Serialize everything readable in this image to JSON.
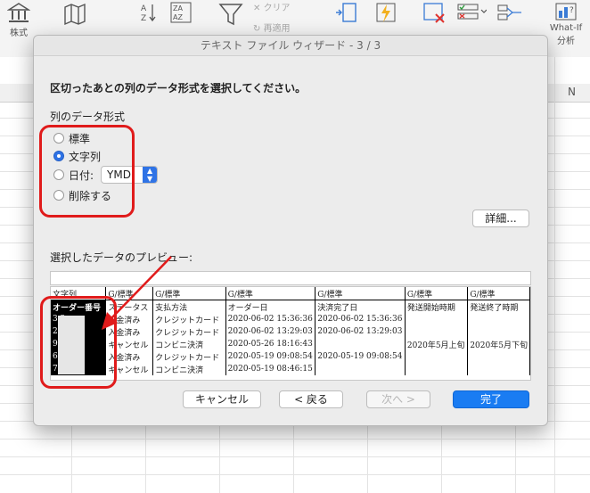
{
  "ribbon": {
    "stock_label": "株式",
    "clear_label": "クリア",
    "reapply_label": "再適用",
    "what_if_label": "What-If",
    "analysis_label": "分析"
  },
  "sheet": {
    "col_n": "N"
  },
  "dialog": {
    "title": "テキスト ファイル ウィザード - 3 / 3",
    "heading": "区切ったあとの列のデータ形式を選択してください。",
    "format_section": "列のデータ形式",
    "options": [
      {
        "label": "標準",
        "selected": false
      },
      {
        "label": "文字列",
        "selected": true
      },
      {
        "label": "日付:",
        "selected": false
      },
      {
        "label": "削除する",
        "selected": false
      }
    ],
    "date_format": "YMD",
    "advanced_button": "詳細...",
    "preview_label": "選択したデータのプレビュー:",
    "preview": {
      "headers": [
        "文字列",
        "G/標準",
        "G/標準",
        "G/標準",
        "G/標準",
        "G/標準",
        "G/標準"
      ],
      "columns": [
        "オーダー番号",
        "ステータス",
        "支払方法",
        "オーダー日",
        "決済完了日",
        "発送開始時期",
        "発送終了時期"
      ],
      "rows": [
        [
          "3      2",
          "入金済み",
          "クレジットカード",
          "2020-06-02 15:36:36",
          "2020-06-02 15:36:36",
          "",
          ""
        ],
        [
          "2      0",
          "入金済み",
          "クレジットカード",
          "2020-06-02 13:29:03",
          "2020-06-02 13:29:03",
          "",
          ""
        ],
        [
          "9      7",
          "キャンセル",
          "コンビニ決済",
          "2020-05-26 18:16:43",
          "",
          "2020年5月上旬",
          "2020年5月下旬"
        ],
        [
          "6      9",
          "入金済み",
          "クレジットカード",
          "2020-05-19 09:08:54",
          "2020-05-19 09:08:54",
          "",
          ""
        ],
        [
          "79     9",
          "キャンセル",
          "コンビニ決済",
          "2020-05-19 08:46:15",
          "",
          "",
          ""
        ]
      ]
    },
    "cancel_button": "キャンセル",
    "back_button": "< 戻る",
    "next_button": "次へ >",
    "finish_button": "完了"
  },
  "colors": {
    "accent": "#1a7cf2",
    "annotation": "#e01b1b"
  }
}
